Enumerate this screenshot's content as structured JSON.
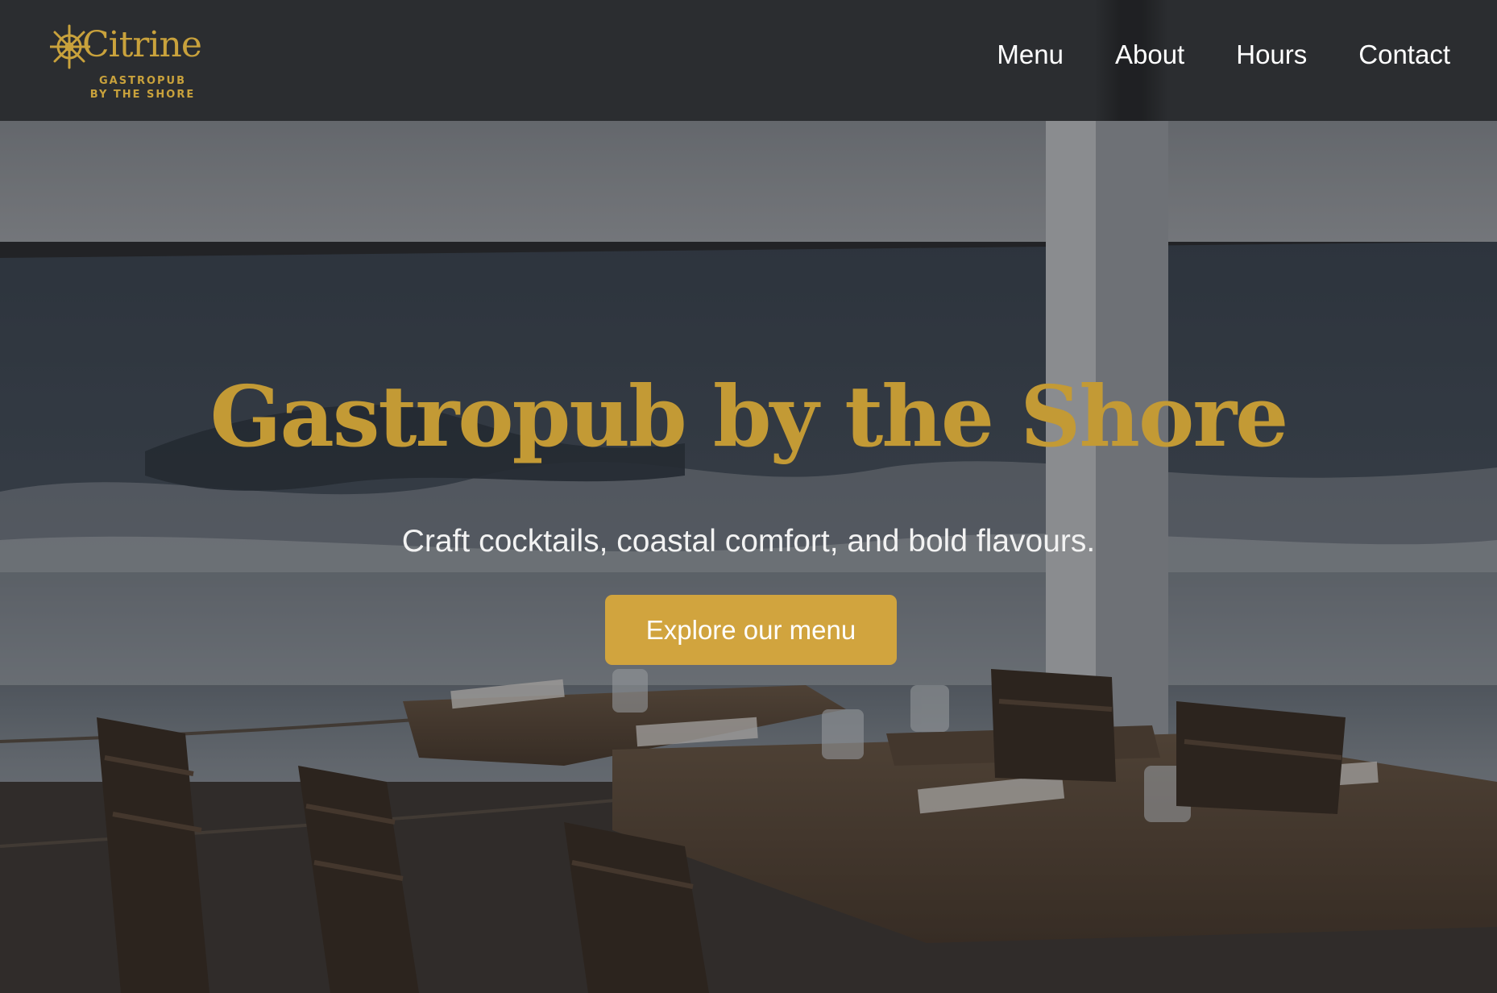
{
  "brand": {
    "name": "Citrine",
    "tagline_line1": "GASTROPUB",
    "tagline_line2": "BY THE SHORE",
    "logo_icon": "ship-wheel-icon",
    "color": "#c9a23c"
  },
  "nav": {
    "items": [
      {
        "label": "Menu"
      },
      {
        "label": "About"
      },
      {
        "label": "Hours"
      },
      {
        "label": "Contact"
      }
    ]
  },
  "hero": {
    "title": "Gastropub by the Shore",
    "subtitle": "Craft cocktails, coastal comfort, and bold flavours.",
    "cta_label": "Explore our menu",
    "background": "seaside-terrace-dining-photo"
  },
  "colors": {
    "header_bg": "#2b2d30",
    "accent_gold": "#c39a35",
    "button_bg": "#d1a43e",
    "nav_text": "#ffffff"
  }
}
